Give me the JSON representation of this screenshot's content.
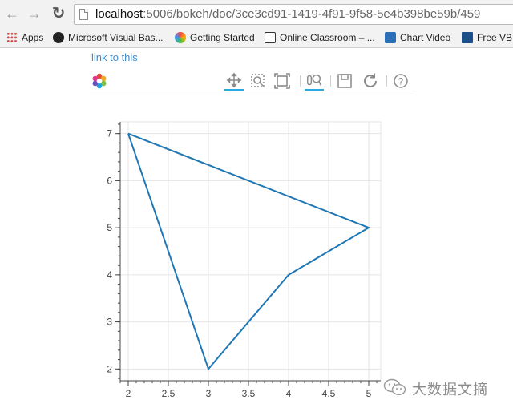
{
  "browser": {
    "url_host": "localhost",
    "url_rest": ":5006/bokeh/doc/3ce3cd91-1419-4f91-9f58-5e4b398be59b/459",
    "icons": {
      "back": "back-arrow-icon",
      "forward": "forward-arrow-icon",
      "reload": "reload-icon",
      "page": "page-icon"
    },
    "bookmarks": [
      {
        "label": "Apps",
        "icon": "apps-grid-icon"
      },
      {
        "label": "Microsoft Visual Bas...",
        "icon": "vb-logo-icon"
      },
      {
        "label": "Getting Started",
        "icon": "getting-started-icon"
      },
      {
        "label": "Online Classroom – ...",
        "icon": "classroom-icon"
      },
      {
        "label": "Chart Video",
        "icon": "chart-icon"
      },
      {
        "label": "Free VB",
        "icon": "xl-icon"
      }
    ]
  },
  "page": {
    "link_label": "link to this",
    "link_color": "#428bca"
  },
  "toolbar": {
    "tools": [
      {
        "name": "pan",
        "icon": "pan-icon",
        "active": true
      },
      {
        "name": "box-zoom",
        "icon": "box-zoom-icon",
        "active": false
      },
      {
        "name": "resize",
        "icon": "resize-icon",
        "active": false
      },
      {
        "name": "wheel-zoom",
        "icon": "wheel-zoom-icon",
        "active": true
      },
      {
        "name": "save",
        "icon": "save-icon",
        "active": false
      },
      {
        "name": "reset",
        "icon": "reset-icon",
        "active": false
      },
      {
        "name": "help",
        "icon": "help-icon",
        "active": false
      }
    ],
    "active_color": "#26aae1"
  },
  "chart_data": {
    "type": "line",
    "x": [
      2,
      5,
      4,
      3,
      2
    ],
    "y": [
      7,
      5,
      4,
      2,
      7
    ],
    "xlim": [
      1.9,
      5.15
    ],
    "ylim": [
      1.75,
      7.25
    ],
    "x_ticks": [
      "2",
      "2.5",
      "3",
      "3.5",
      "4",
      "4.5",
      "5"
    ],
    "y_ticks": [
      "2",
      "3",
      "4",
      "5",
      "6",
      "7"
    ],
    "grid": true,
    "line_color": "#1f77b4",
    "title": "",
    "xlabel": "",
    "ylabel": ""
  },
  "watermark": {
    "text": "大数据文摘",
    "icon": "wechat-icon"
  }
}
